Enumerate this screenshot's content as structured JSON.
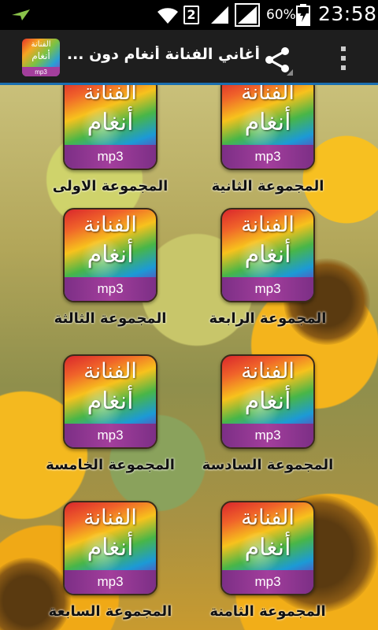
{
  "status_bar": {
    "sim_slot": "2",
    "battery_percent": "60%",
    "time": "23:58",
    "icons": [
      "notification-icon",
      "wifi-icon",
      "signal-icon",
      "signal-icon",
      "battery-charging-icon"
    ]
  },
  "action_bar": {
    "title": "أغاني الفنانة أنغام دون ...",
    "app_icon": {
      "line1": "الفنانة",
      "line2": "أنغام",
      "line3": "mp3"
    },
    "icons": [
      "share-icon",
      "overflow-menu-icon"
    ]
  },
  "tile": {
    "line1": "الفنانة",
    "line2": "أنغام",
    "label": "mp3"
  },
  "groups": [
    {
      "label": "المجموعة الثانية"
    },
    {
      "label": "المجموعة الاولى"
    },
    {
      "label": "المجموعة الرابعة"
    },
    {
      "label": "المجموعة الثالثة"
    },
    {
      "label": "المجموعة السادسة"
    },
    {
      "label": "المجموعة الخامسة"
    },
    {
      "label": "المجموعة الثامنة"
    },
    {
      "label": "المجموعة السابعة"
    }
  ],
  "colors": {
    "action_bar_bg": "#1e1e1e",
    "accent_underline": "#1a6fb0",
    "tile_strip": "#a33e9c"
  }
}
